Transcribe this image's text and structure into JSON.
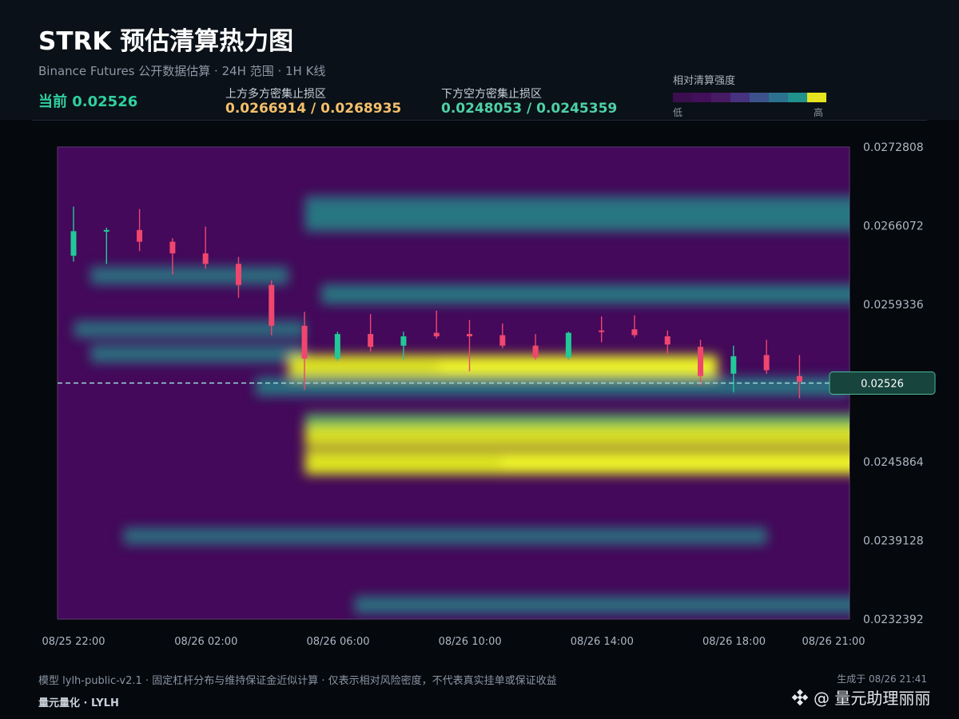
{
  "header": {
    "title": "STRK 预估清算热力图",
    "subtitle": "Binance Futures 公开数据估算 · 24H 范围 · 1H K线",
    "current_label": "当前 0.02526",
    "upper_zone_label": "上方多方密集止损区",
    "upper_zone_value": "0.0266914 / 0.0268935",
    "lower_zone_label": "下方空方密集止损区",
    "lower_zone_value": "0.0248053 / 0.0245359"
  },
  "legend": {
    "title": "相对清算强度",
    "low": "低",
    "high": "高",
    "colors": [
      "#3b0f4f",
      "#420f5a",
      "#471a66",
      "#46327e",
      "#3b528b",
      "#2c728e",
      "#21918c",
      "#e6e41f"
    ]
  },
  "colors": {
    "up": "#20c997",
    "down": "#f0466e",
    "current_line": "#9fd8d8",
    "upper_zone": "#f4c06b",
    "lower_zone": "#4fd1a5"
  },
  "chart_data": {
    "type": "heatmap",
    "title": "STRK 预估清算热力图",
    "y_range": [
      0.0232392,
      0.0272808
    ],
    "y_ticks": [
      "0.0272808",
      "0.0266072",
      "0.0259336",
      "0.0245864",
      "0.0239128",
      "0.0232392"
    ],
    "x_ticks": [
      "08/25 22:00",
      "08/26 02:00",
      "08/26 06:00",
      "08/26 10:00",
      "08/26 14:00",
      "08/26 18:00",
      "08/26 21:00"
    ],
    "x_tick_hours": [
      0,
      4,
      8,
      12,
      16,
      20,
      23
    ],
    "current_price": 0.02526,
    "current_price_label": "0.02526",
    "candles": [
      {
        "t": 0,
        "o": 0.02635,
        "c": 0.02656,
        "h": 0.02677,
        "l": 0.0263
      },
      {
        "t": 1,
        "o": 0.02656,
        "c": 0.02657,
        "h": 0.02659,
        "l": 0.02628
      },
      {
        "t": 2,
        "o": 0.02657,
        "c": 0.02647,
        "h": 0.02675,
        "l": 0.02639
      },
      {
        "t": 3,
        "o": 0.02647,
        "c": 0.02637,
        "h": 0.0265,
        "l": 0.02619
      },
      {
        "t": 4,
        "o": 0.02637,
        "c": 0.02628,
        "h": 0.0266,
        "l": 0.02624
      },
      {
        "t": 5,
        "o": 0.02628,
        "c": 0.0261,
        "h": 0.02634,
        "l": 0.02599
      },
      {
        "t": 6,
        "o": 0.0261,
        "c": 0.02575,
        "h": 0.02614,
        "l": 0.02567
      },
      {
        "t": 7,
        "o": 0.02575,
        "c": 0.02547,
        "h": 0.02587,
        "l": 0.0252
      },
      {
        "t": 8,
        "o": 0.02547,
        "c": 0.02568,
        "h": 0.0257,
        "l": 0.02545
      },
      {
        "t": 9,
        "o": 0.02568,
        "c": 0.02557,
        "h": 0.02585,
        "l": 0.02553
      },
      {
        "t": 10,
        "o": 0.02558,
        "c": 0.02566,
        "h": 0.0257,
        "l": 0.02546
      },
      {
        "t": 11,
        "o": 0.02569,
        "c": 0.02566,
        "h": 0.02588,
        "l": 0.02564
      },
      {
        "t": 12,
        "o": 0.02568,
        "c": 0.02566,
        "h": 0.0258,
        "l": 0.02536
      },
      {
        "t": 13,
        "o": 0.02567,
        "c": 0.02558,
        "h": 0.02577,
        "l": 0.02556
      },
      {
        "t": 14,
        "o": 0.02558,
        "c": 0.02548,
        "h": 0.02568,
        "l": 0.02546
      },
      {
        "t": 15,
        "o": 0.02548,
        "c": 0.02569,
        "h": 0.0257,
        "l": 0.02546
      },
      {
        "t": 16,
        "o": 0.02571,
        "c": 0.0257,
        "h": 0.02583,
        "l": 0.02561
      },
      {
        "t": 17,
        "o": 0.02572,
        "c": 0.02567,
        "h": 0.02584,
        "l": 0.02565
      },
      {
        "t": 18,
        "o": 0.02566,
        "c": 0.02559,
        "h": 0.02571,
        "l": 0.02551
      },
      {
        "t": 19,
        "o": 0.02557,
        "c": 0.02532,
        "h": 0.02563,
        "l": 0.02524
      },
      {
        "t": 20,
        "o": 0.02534,
        "c": 0.02549,
        "h": 0.02558,
        "l": 0.02518
      },
      {
        "t": 21,
        "o": 0.0255,
        "c": 0.02537,
        "h": 0.02563,
        "l": 0.02534
      },
      {
        "t": 22,
        "o": 0.02532,
        "c": 0.02527,
        "h": 0.0255,
        "l": 0.02513
      },
      {
        "t": 23,
        "o": 0.0253,
        "c": 0.02526,
        "h": 0.02534,
        "l": 0.0252
      }
    ],
    "bands": [
      {
        "price": 0.02678,
        "t_start": 7.5,
        "intensity": 0.55
      },
      {
        "price": 0.02664,
        "t_start": 7.5,
        "intensity": 0.6
      },
      {
        "price": 0.02602,
        "t_start": 8,
        "intensity": 0.6
      },
      {
        "price": 0.02618,
        "t_start": 1,
        "t_end": 6.5,
        "intensity": 0.45
      },
      {
        "price": 0.02572,
        "t_start": 0.5,
        "t_end": 7,
        "intensity": 0.4
      },
      {
        "price": 0.02551,
        "t_start": 1,
        "t_end": 7,
        "intensity": 0.45
      },
      {
        "price": 0.0254,
        "t_start": 7,
        "t_end": 19.5,
        "intensity": 0.95
      },
      {
        "price": 0.02523,
        "t_start": 6,
        "t_end": 23.5,
        "intensity": 0.55
      },
      {
        "price": 0.02491,
        "t_start": 7.5,
        "intensity": 0.7
      },
      {
        "price": 0.0248,
        "t_start": 7.5,
        "intensity": 0.85
      },
      {
        "price": 0.02458,
        "t_start": 7.5,
        "intensity": 1.0
      },
      {
        "price": 0.02395,
        "t_start": 2,
        "t_end": 21,
        "intensity": 0.4
      },
      {
        "price": 0.02336,
        "t_start": 9,
        "intensity": 0.45
      }
    ]
  },
  "footer": {
    "note": "模型 lylh-public-v2.1 · 固定杠杆分布与维持保证金近似计算 · 仅表示相对风险密度，不代表真实挂单或保证收益",
    "generated": "生成于 08/26 21:41",
    "brand": "量元量化 · LYLH",
    "watermark": "@ 量元助理丽丽"
  }
}
